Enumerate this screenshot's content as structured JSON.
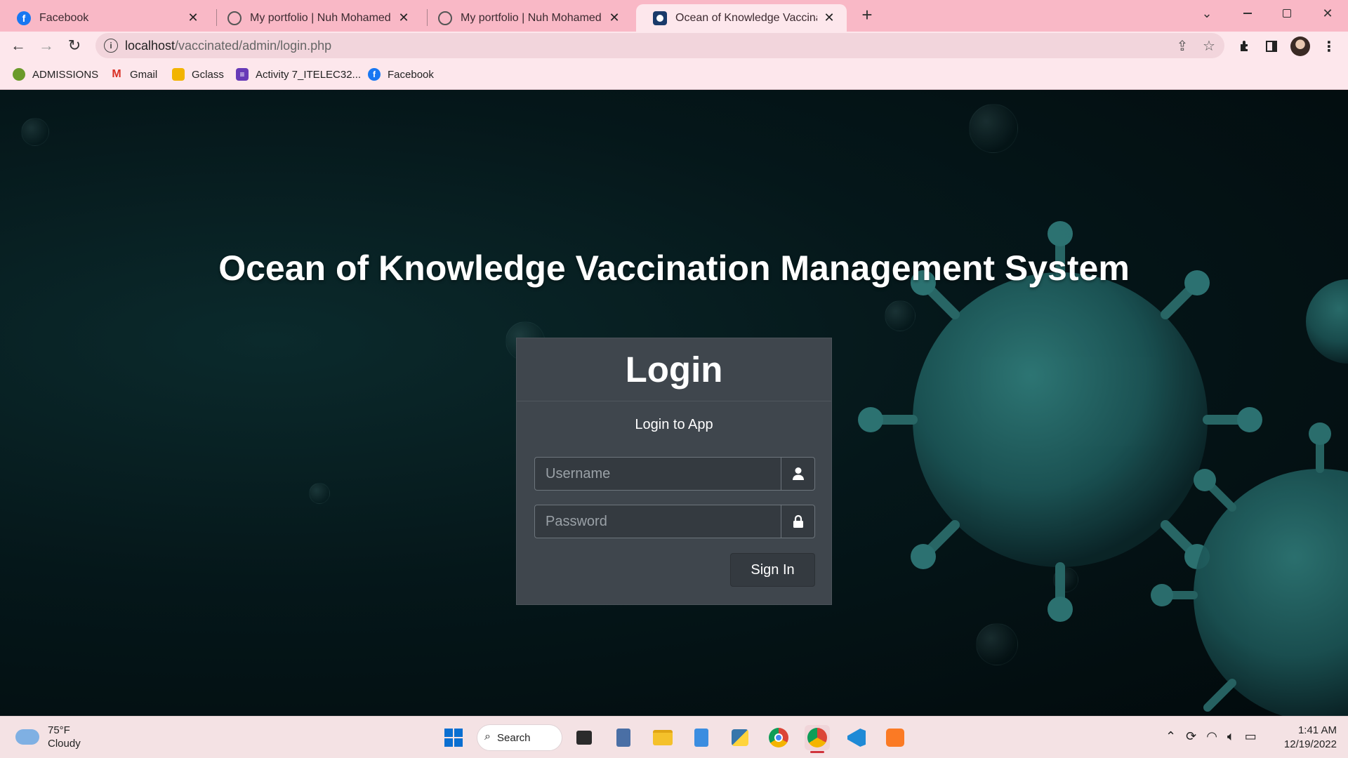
{
  "browser": {
    "tabs": [
      {
        "title": "Facebook",
        "icon": "facebook-icon",
        "active": false
      },
      {
        "title": "My portfolio | Nuh Mohamed Ali",
        "icon": "globe-icon",
        "active": false
      },
      {
        "title": "My portfolio | Nuh Mohamed Ali",
        "icon": "globe-icon",
        "active": false
      },
      {
        "title": "Ocean of Knowledge Vaccination",
        "icon": "app-favicon-icon",
        "active": true
      }
    ],
    "url_host": "localhost",
    "url_path": "/vaccinated/admin/login.php",
    "bookmarks": [
      {
        "label": "ADMISSIONS",
        "icon": "admissions-icon"
      },
      {
        "label": "Gmail",
        "icon": "gmail-icon"
      },
      {
        "label": "Gclass",
        "icon": "google-classroom-icon"
      },
      {
        "label": "Activity 7_ITELEC32...",
        "icon": "forms-icon"
      },
      {
        "label": "Facebook",
        "icon": "facebook-icon"
      }
    ]
  },
  "page": {
    "title": "Ocean of Knowledge Vaccination Management System",
    "login": {
      "heading": "Login",
      "subtitle": "Login to App",
      "username_placeholder": "Username",
      "password_placeholder": "Password",
      "submit_label": "Sign In"
    }
  },
  "taskbar": {
    "weather_temp": "75°F",
    "weather_desc": "Cloudy",
    "search_label": "Search",
    "time": "1:41 AM",
    "date": "12/19/2022"
  },
  "colors": {
    "chrome_tabstrip": "#f9b8c6",
    "chrome_toolbar": "#fde7ec",
    "card_bg": "#3f464d",
    "button_bg": "#343a40",
    "virus_teal": "#1f5f5f"
  }
}
